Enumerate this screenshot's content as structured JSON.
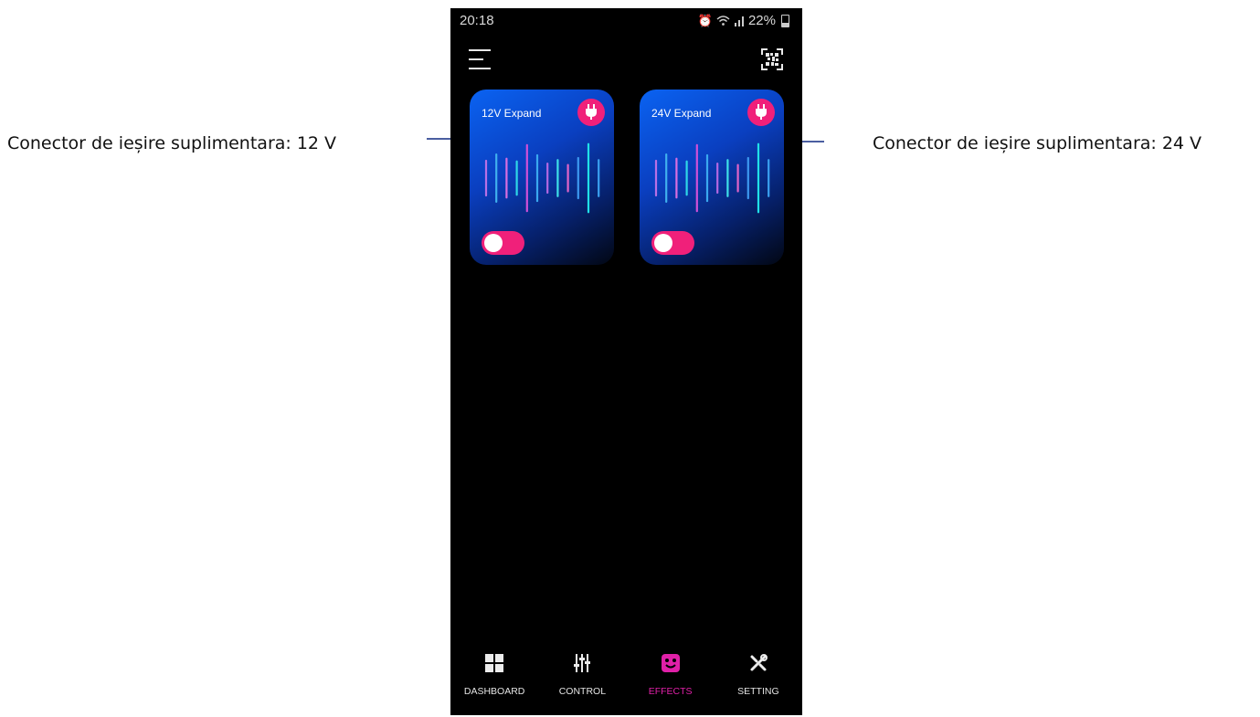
{
  "annotations": {
    "left": "Conector de ieșire suplimentara: 12 V",
    "right": "Conector de ieșire suplimentara: 24 V"
  },
  "status_bar": {
    "time": "20:18",
    "battery": "22%",
    "icons": [
      "alarm-icon",
      "wifi-icon",
      "signal-icon",
      "battery-icon"
    ]
  },
  "header": {
    "menu_icon": "hamburger-menu-icon",
    "scan_icon": "qr-code-scan-icon"
  },
  "cards": [
    {
      "title": "12V Expand",
      "toggle_on": false,
      "icon": "plug-icon"
    },
    {
      "title": "24V Expand",
      "toggle_on": false,
      "icon": "plug-icon"
    }
  ],
  "bottom_nav": {
    "items": [
      {
        "label": "DASHBOARD",
        "icon": "grid-icon",
        "active": false
      },
      {
        "label": "CONTROL",
        "icon": "sliders-icon",
        "active": false
      },
      {
        "label": "EFFECTS",
        "icon": "effects-icon",
        "active": true
      },
      {
        "label": "SETTING",
        "icon": "tools-icon",
        "active": false
      }
    ]
  },
  "colors": {
    "accent_pink": "#f0207a",
    "active_nav": "#e020a8",
    "card_blue": "#0a63f2",
    "background": "#000000"
  }
}
